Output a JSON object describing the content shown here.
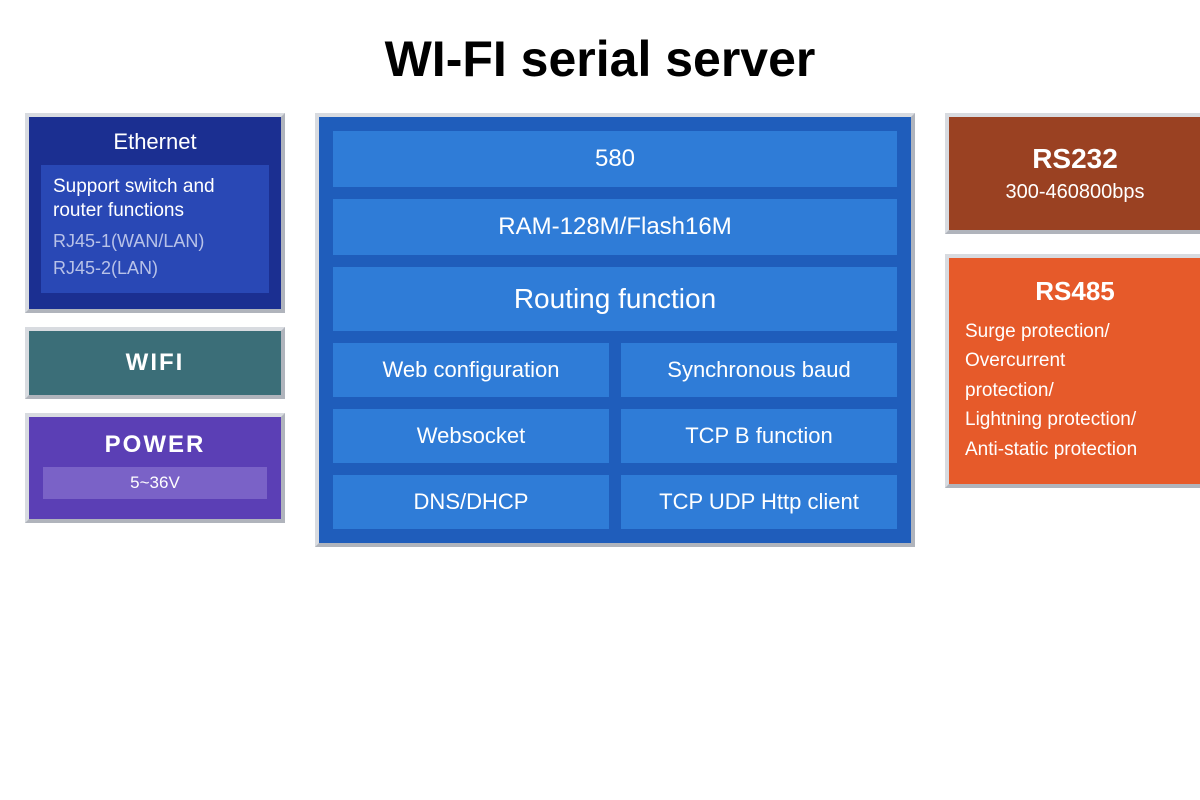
{
  "title": "WI-FI serial server",
  "left": {
    "ethernet": {
      "title": "Ethernet",
      "support": "Support switch and router functions",
      "port1": "RJ45-1(WAN/LAN)",
      "port2": "RJ45-2(LAN)"
    },
    "wifi": {
      "label": "WIFI"
    },
    "power": {
      "title": "POWER",
      "spec": "5~36V"
    }
  },
  "center": {
    "row1": "580",
    "row2": "RAM-128M/Flash16M",
    "row3": "Routing function",
    "row4": {
      "a": "Web configuration",
      "b": "Synchronous baud"
    },
    "row5": {
      "a": "Websocket",
      "b": "TCP B function"
    },
    "row6": {
      "a": "DNS/DHCP",
      "b": "TCP UDP Http client"
    }
  },
  "right": {
    "rs232": {
      "title": "RS232",
      "spec": "300-460800bps"
    },
    "rs485": {
      "title": "RS485",
      "line1": "Surge protection/",
      "line2": "Overcurrent",
      "line3": "protection/",
      "line4": "Lightning protection/",
      "line5": "Anti-static protection"
    }
  }
}
